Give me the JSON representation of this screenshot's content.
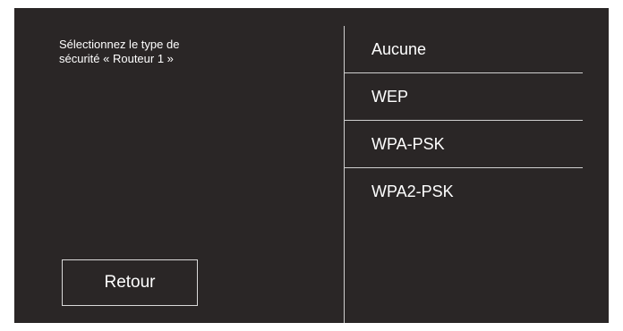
{
  "dialog": {
    "prompt": "Sélectionnez le type de\nsécurité « Routeur 1 »",
    "back_label": "Retour"
  },
  "security_options": [
    "Aucune",
    "WEP",
    "WPA-PSK",
    "WPA2-PSK"
  ],
  "colors": {
    "background": "#2a2626",
    "text": "#ffffff",
    "divider": "#cfcfcf"
  }
}
